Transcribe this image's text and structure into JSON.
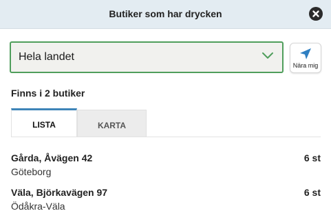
{
  "header": {
    "title": "Butiker som har drycken"
  },
  "location_select": {
    "value": "Hela landet"
  },
  "near_button": {
    "label": "Nära mig"
  },
  "result_count": "Finns i 2 butiker",
  "tabs": [
    {
      "label": "LISTA",
      "active": true
    },
    {
      "label": "KARTA",
      "active": false
    }
  ],
  "stores": [
    {
      "name": "Gårda, Åvägen 42",
      "city": "Göteborg",
      "quantity": "6 st"
    },
    {
      "name": "Väla, Björkavägen 97",
      "city": "Ödåkra-Väla",
      "quantity": "6 st"
    }
  ],
  "colors": {
    "accent_green": "#4f9e5b",
    "tab_blue": "#3d84b8",
    "header_bg": "#e3ecf2",
    "locate_blue": "#2f7fc1"
  },
  "icons": {
    "close": "close-icon",
    "dropdown": "chevron-down-icon",
    "locate": "location-arrow-icon"
  }
}
